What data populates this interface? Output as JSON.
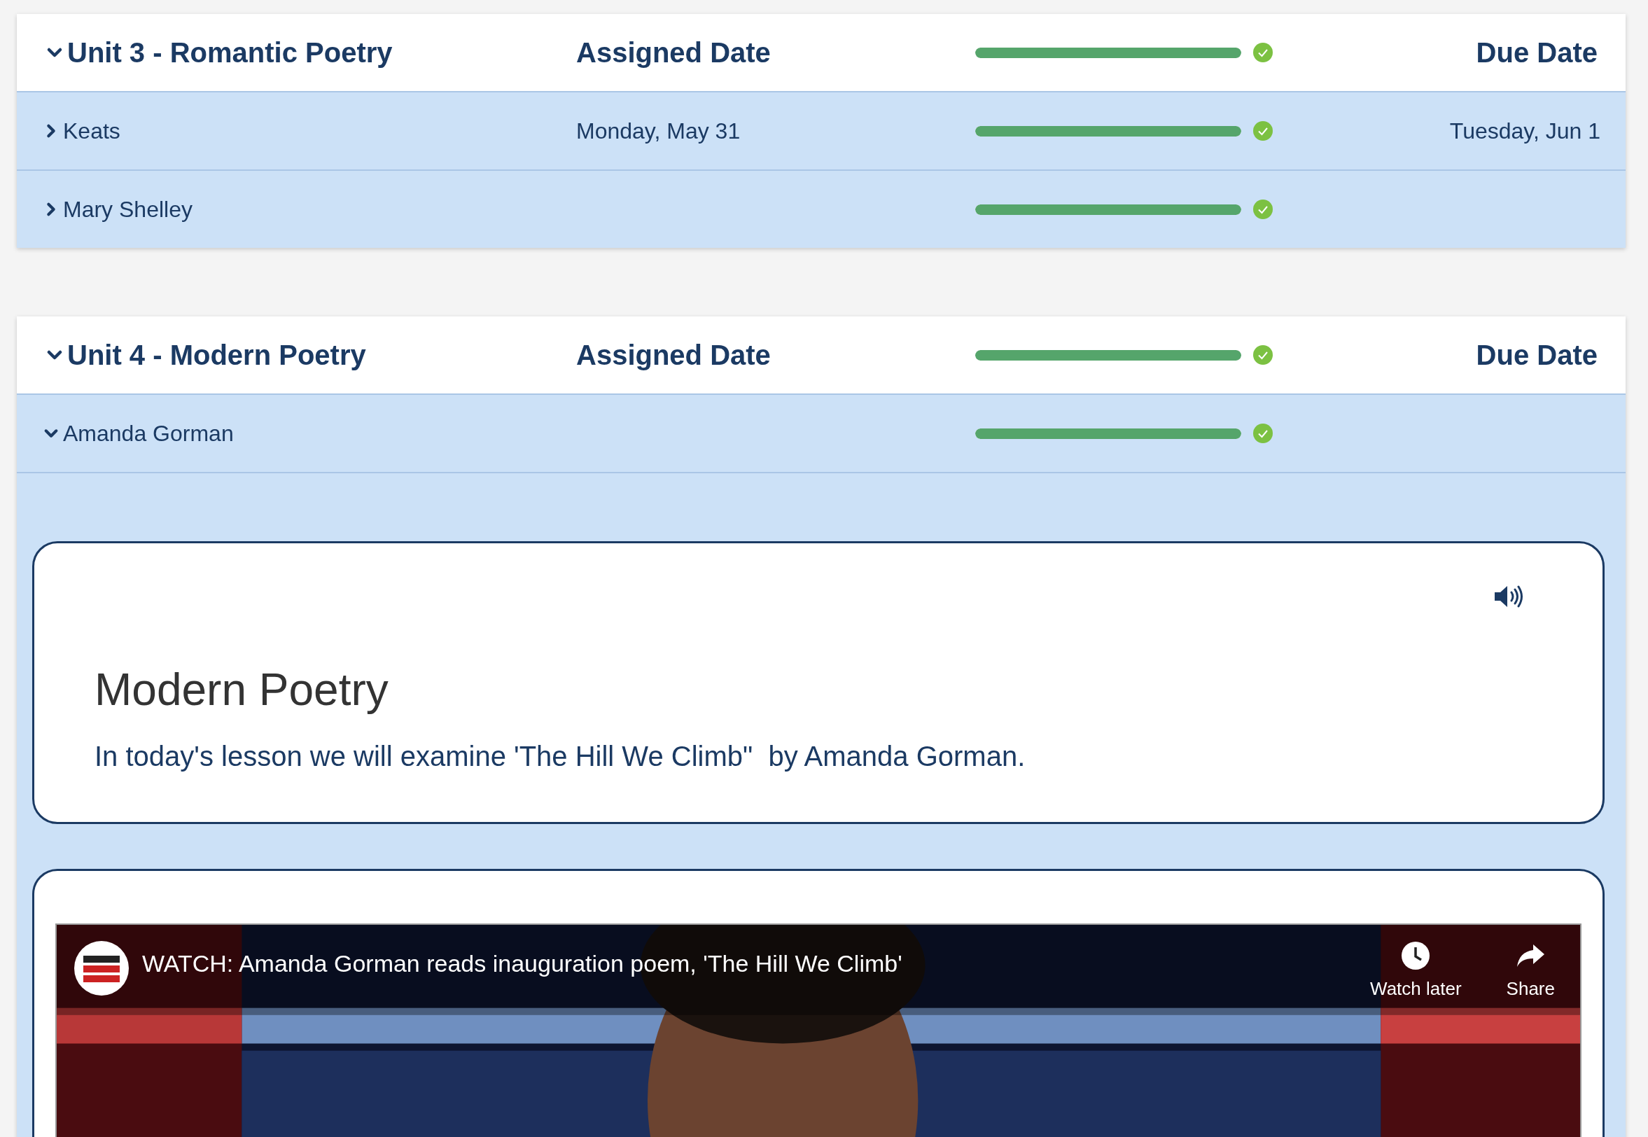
{
  "units": [
    {
      "title": "Unit 3 - Romantic Poetry",
      "expanded": true,
      "assigned_header": "Assigned Date",
      "level": 1,
      "complete": true,
      "due_header": "Due Date",
      "lessons": [
        {
          "title": "Keats",
          "expanded": false,
          "assigned": "Monday, May 31",
          "level": 1,
          "complete": true,
          "due": "Tuesday, Jun 1"
        },
        {
          "title": "Mary Shelley",
          "expanded": false,
          "level": 1,
          "complete": true
        }
      ]
    },
    {
      "title": "Unit 4 - Modern Poetry",
      "expanded": true,
      "assigned_header": "Assigned Date",
      "level": 1,
      "complete": true,
      "due_header": "Due Date",
      "lessons": [
        {
          "title": "Amanda Gorman",
          "expanded": true,
          "level": 1,
          "complete": true,
          "content": {
            "heading": "Modern Poetry",
            "text": "In today's lesson we will examine 'The Hill We Climb\"  by Amanda Gorman.",
            "video": {
              "title": "WATCH: Amanda Gorman reads inauguration poem, 'The Hill We Climb'",
              "actions": [
                {
                  "kind": "watch_later",
                  "label": "Watch later"
                },
                {
                  "kind": "share",
                  "label": "Share"
                }
              ]
            }
          }
        }
      ]
    }
  ]
}
